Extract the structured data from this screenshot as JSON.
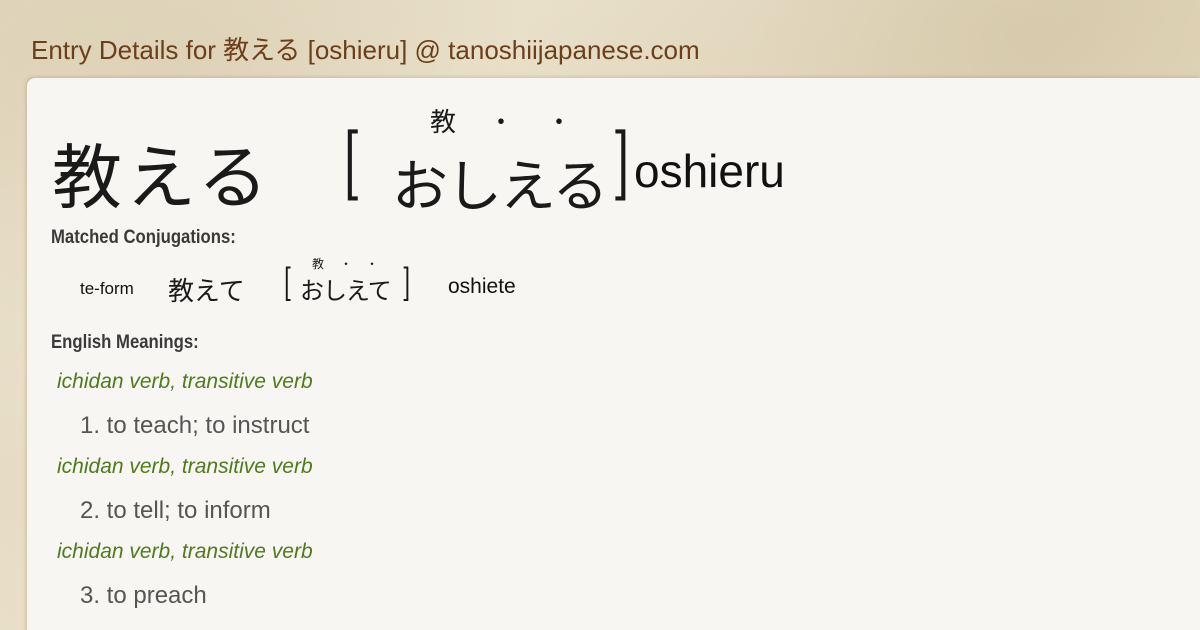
{
  "header": {
    "title": "Entry Details for 教える [oshieru] @ tanoshiijapanese.com"
  },
  "entry": {
    "headword": "教える",
    "reading_furigana": [
      "教",
      "・",
      "・"
    ],
    "reading_kana": "おしえる",
    "romaji": "oshieru"
  },
  "conjugations": {
    "label": "Matched Conjugations:",
    "items": [
      {
        "type": "te-form",
        "kanji": "教えて",
        "furigana": [
          "教",
          "・",
          "・"
        ],
        "kana": "おしえて",
        "romaji": "oshiete"
      }
    ]
  },
  "meanings": {
    "label": "English Meanings:",
    "items": [
      {
        "pos": "ichidan verb, transitive verb",
        "text": "1. to teach; to instruct"
      },
      {
        "pos": "ichidan verb, transitive verb",
        "text": "2. to tell; to inform"
      },
      {
        "pos": "ichidan verb, transitive verb",
        "text": "3. to preach"
      }
    ]
  },
  "colors": {
    "header_text": "#6b3f1a",
    "pos_text": "#4f7a1e",
    "card_bg": "#f7f6f2"
  }
}
